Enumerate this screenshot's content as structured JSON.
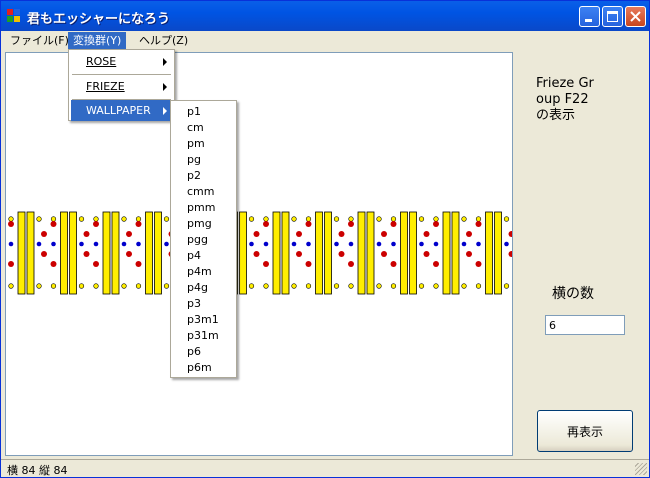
{
  "window": {
    "title": "君もエッシャーになろう",
    "icon": "app-icon"
  },
  "menubar": [
    {
      "label": "ファイル(F)"
    },
    {
      "label": "変換群(Y)",
      "active": true
    },
    {
      "label": "ヘルプ(Z)"
    }
  ],
  "transform_menu": {
    "items": [
      {
        "label": "ROSE",
        "submenu": true
      },
      {
        "label": "FRIEZE",
        "submenu": true
      },
      {
        "label": "WALLPAPER",
        "submenu": true,
        "highlighted": true
      }
    ]
  },
  "wallpaper_submenu": {
    "items": [
      "p1",
      "cm",
      "pm",
      "pg",
      "p2",
      "cmm",
      "pmm",
      "pmg",
      "pgg",
      "p4",
      "p4m",
      "p4g",
      "p3",
      "p3m1",
      "p31m",
      "p6",
      "p6m"
    ]
  },
  "panel": {
    "info_text": "Frieze Group F22 の表示",
    "count_label": "横の数",
    "count_value": "6",
    "redisplay_label": "再表示"
  },
  "status": {
    "text": "横 84 縦 84"
  },
  "colors": {
    "bar_fill": "#ffee00",
    "red_dot": "#cc0000",
    "blue_dot": "#0000cc",
    "yellow_dot": "#ffee00",
    "highlight": "#316ac5"
  }
}
